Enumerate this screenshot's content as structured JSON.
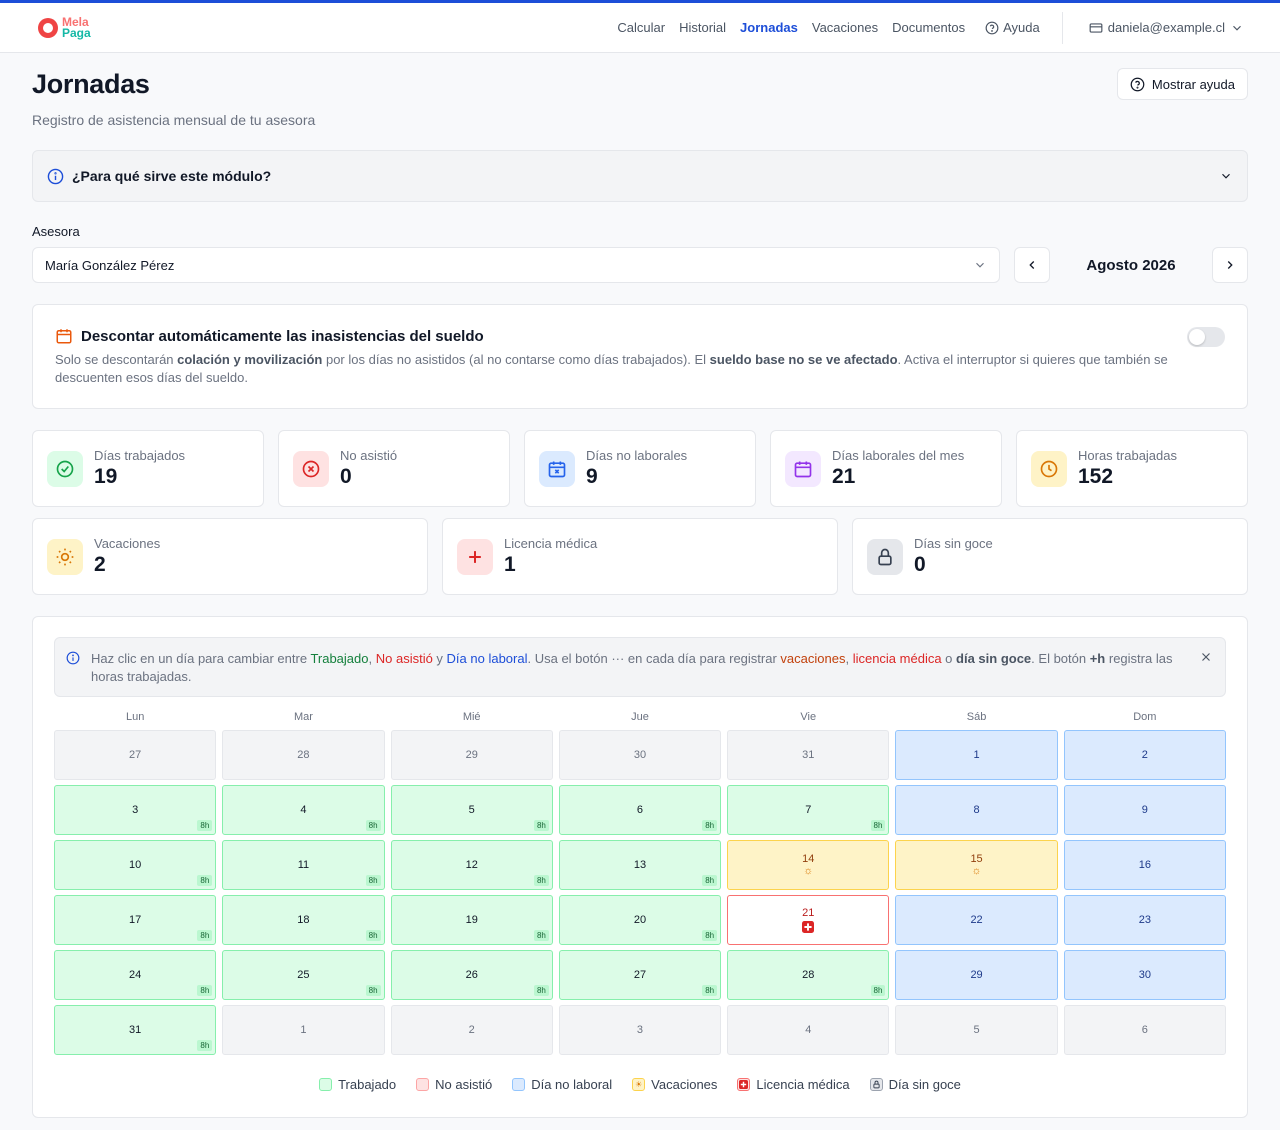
{
  "brand": {
    "line1": "Mela",
    "line2": "Paga"
  },
  "nav": {
    "links": [
      "Calcular",
      "Historial",
      "Jornadas",
      "Vacaciones",
      "Documentos"
    ],
    "active": "Jornadas",
    "help": "Ayuda",
    "user": "daniela@example.cl"
  },
  "page": {
    "title": "Jornadas",
    "subtitle": "Registro de asistencia mensual de tu asesora",
    "help_button": "Mostrar ayuda"
  },
  "accordion": {
    "title": "¿Para qué sirve este módulo?"
  },
  "asesora": {
    "label": "Asesora",
    "selected": "María González Pérez"
  },
  "month": {
    "label": "Agosto 2026"
  },
  "deduct": {
    "title": "Descontar automáticamente las inasistencias del sueldo",
    "t1": "Solo se descontarán ",
    "b1": "colación y movilización",
    "t2": " por los días no asistidos (al no contarse como días trabajados). El ",
    "b2": "sueldo base no se ve afectado",
    "t3": ". Activa el interruptor si quieres que también se descuenten esos días del sueldo.",
    "enabled": false
  },
  "stats": [
    {
      "label": "Días trabajados",
      "value": "19",
      "icon": "check-circle-icon"
    },
    {
      "label": "No asistió",
      "value": "0",
      "icon": "x-circle-icon"
    },
    {
      "label": "Días no laborales",
      "value": "9",
      "icon": "calendar-x-icon"
    },
    {
      "label": "Días laborales del mes",
      "value": "21",
      "icon": "calendar-icon"
    },
    {
      "label": "Horas trabajadas",
      "value": "152",
      "icon": "clock-icon"
    }
  ],
  "stats2": [
    {
      "label": "Vacaciones",
      "value": "2",
      "icon": "sun-icon"
    },
    {
      "label": "Licencia médica",
      "value": "1",
      "icon": "plus-icon"
    },
    {
      "label": "Días sin goce",
      "value": "0",
      "icon": "lock-icon"
    }
  ],
  "info": {
    "p1": "Haz clic en un día para cambiar entre ",
    "trabajado": "Trabajado",
    "c1": ", ",
    "no_asistio": "No asistió",
    "y": " y ",
    "no_laboral": "Día no laboral",
    "p2": ". Usa el botón ··· en cada día para registrar ",
    "vacaciones": "vacaciones",
    "c2": ", ",
    "licencia": "licencia médica",
    "o": " o ",
    "sin_goce": "día sin goce",
    "p3": ". El botón ",
    "h": "+h",
    "p4": " registra las horas trabajadas."
  },
  "calendar": {
    "weekdays": [
      "Lun",
      "Mar",
      "Mié",
      "Jue",
      "Vie",
      "Sáb",
      "Dom"
    ],
    "days": [
      {
        "n": "27",
        "s": "out"
      },
      {
        "n": "28",
        "s": "out"
      },
      {
        "n": "29",
        "s": "out"
      },
      {
        "n": "30",
        "s": "out"
      },
      {
        "n": "31",
        "s": "out"
      },
      {
        "n": "1",
        "s": "off"
      },
      {
        "n": "2",
        "s": "off"
      },
      {
        "n": "3",
        "s": "work",
        "h": "8h"
      },
      {
        "n": "4",
        "s": "work",
        "h": "8h"
      },
      {
        "n": "5",
        "s": "work",
        "h": "8h"
      },
      {
        "n": "6",
        "s": "work",
        "h": "8h"
      },
      {
        "n": "7",
        "s": "work",
        "h": "8h"
      },
      {
        "n": "8",
        "s": "off"
      },
      {
        "n": "9",
        "s": "off"
      },
      {
        "n": "10",
        "s": "work",
        "h": "8h"
      },
      {
        "n": "11",
        "s": "work",
        "h": "8h"
      },
      {
        "n": "12",
        "s": "work",
        "h": "8h"
      },
      {
        "n": "13",
        "s": "work",
        "h": "8h"
      },
      {
        "n": "14",
        "s": "vac"
      },
      {
        "n": "15",
        "s": "vac"
      },
      {
        "n": "16",
        "s": "off"
      },
      {
        "n": "17",
        "s": "work",
        "h": "8h"
      },
      {
        "n": "18",
        "s": "work",
        "h": "8h"
      },
      {
        "n": "19",
        "s": "work",
        "h": "8h"
      },
      {
        "n": "20",
        "s": "work",
        "h": "8h"
      },
      {
        "n": "21",
        "s": "med"
      },
      {
        "n": "22",
        "s": "off"
      },
      {
        "n": "23",
        "s": "off"
      },
      {
        "n": "24",
        "s": "work",
        "h": "8h"
      },
      {
        "n": "25",
        "s": "work",
        "h": "8h"
      },
      {
        "n": "26",
        "s": "work",
        "h": "8h"
      },
      {
        "n": "27",
        "s": "work",
        "h": "8h"
      },
      {
        "n": "28",
        "s": "work",
        "h": "8h"
      },
      {
        "n": "29",
        "s": "off"
      },
      {
        "n": "30",
        "s": "off"
      },
      {
        "n": "31",
        "s": "work",
        "h": "8h"
      },
      {
        "n": "1",
        "s": "out"
      },
      {
        "n": "2",
        "s": "out"
      },
      {
        "n": "3",
        "s": "out"
      },
      {
        "n": "4",
        "s": "out"
      },
      {
        "n": "5",
        "s": "out"
      },
      {
        "n": "6",
        "s": "out"
      }
    ]
  },
  "legend": [
    "Trabajado",
    "No asistió",
    "Día no laboral",
    "Vacaciones",
    "Licencia médica",
    "Día sin goce"
  ],
  "colors": {
    "accent": "#1d4ed8",
    "work": "#dcfce7",
    "off": "#dbeafe",
    "vac": "#fef3c7",
    "med": "#f87171"
  }
}
